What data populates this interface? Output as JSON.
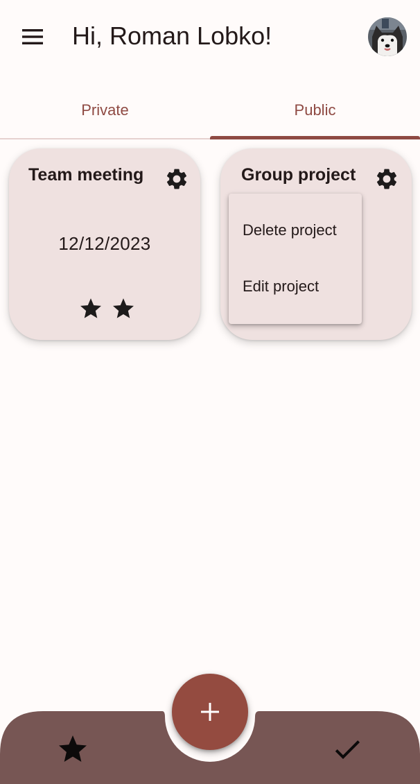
{
  "header": {
    "greeting": "Hi, Roman Lobko!",
    "menu_icon": "hamburger-menu-icon",
    "avatar_icon": "husky-avatar"
  },
  "tabs": [
    {
      "label": "Private",
      "selected": false
    },
    {
      "label": "Public",
      "selected": true
    }
  ],
  "cards": [
    {
      "title": "Team meeting",
      "date": "12/12/2023",
      "stars": 2,
      "settings_icon": "gear-icon"
    },
    {
      "title": "Group project",
      "settings_icon": "gear-icon"
    }
  ],
  "context_menu": {
    "items": [
      {
        "label": "Delete project"
      },
      {
        "label": "Edit project"
      }
    ]
  },
  "bottom_bar": {
    "left_icon": "star-icon",
    "fab_icon": "plus-icon",
    "right_icon": "check-icon"
  },
  "colors": {
    "background": "#fffbfa",
    "accent": "#8f4a43",
    "card": "#efe1e0",
    "bottom_bar": "#775654",
    "fab": "#944b40",
    "text": "#231919"
  }
}
